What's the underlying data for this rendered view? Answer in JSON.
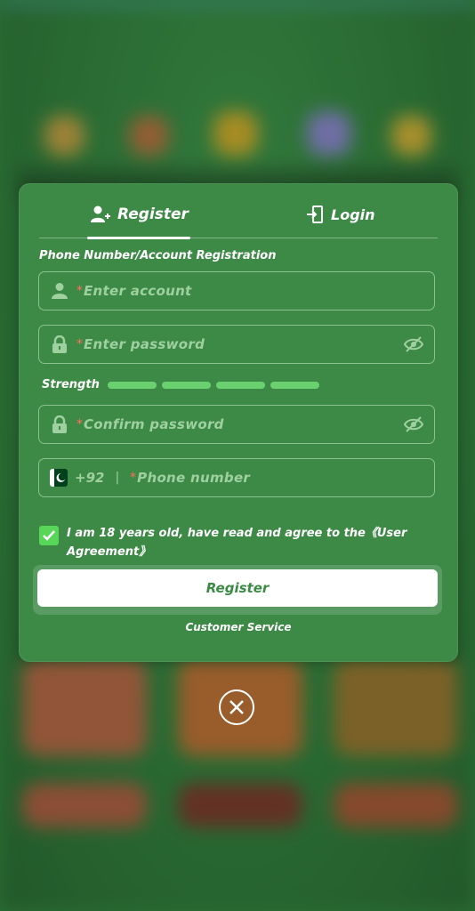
{
  "tabs": [
    {
      "label": "Register",
      "icon": "user-plus-icon",
      "active": true
    },
    {
      "label": "Login",
      "icon": "login-icon",
      "active": false
    }
  ],
  "section_title": "Phone Number/Account Registration",
  "fields": {
    "account": {
      "required_mark": "*",
      "placeholder": "Enter account",
      "icon": "user-icon"
    },
    "password": {
      "required_mark": "*",
      "placeholder": "Enter password",
      "icon": "lock-icon",
      "toggle_icon": "eye-off-icon"
    },
    "confirm_password": {
      "required_mark": "*",
      "placeholder": "Confirm password",
      "icon": "lock-icon",
      "toggle_icon": "eye-off-icon"
    },
    "phone": {
      "country_code": "+92",
      "separator": "|",
      "required_mark": "*",
      "placeholder": "Phone number",
      "flag": "pakistan-flag-icon"
    }
  },
  "strength": {
    "label": "Strength"
  },
  "agreement": {
    "checked": true,
    "text": "I am 18 years old, have read and agree to the《User Agreement》"
  },
  "register_button": {
    "label": "Register"
  },
  "customer_service": {
    "label": "Customer Service"
  },
  "colors": {
    "panel": "#3d8a47",
    "accent_green": "#57d657",
    "required": "#ff6e5e",
    "placeholder": "#9fd0a0"
  }
}
